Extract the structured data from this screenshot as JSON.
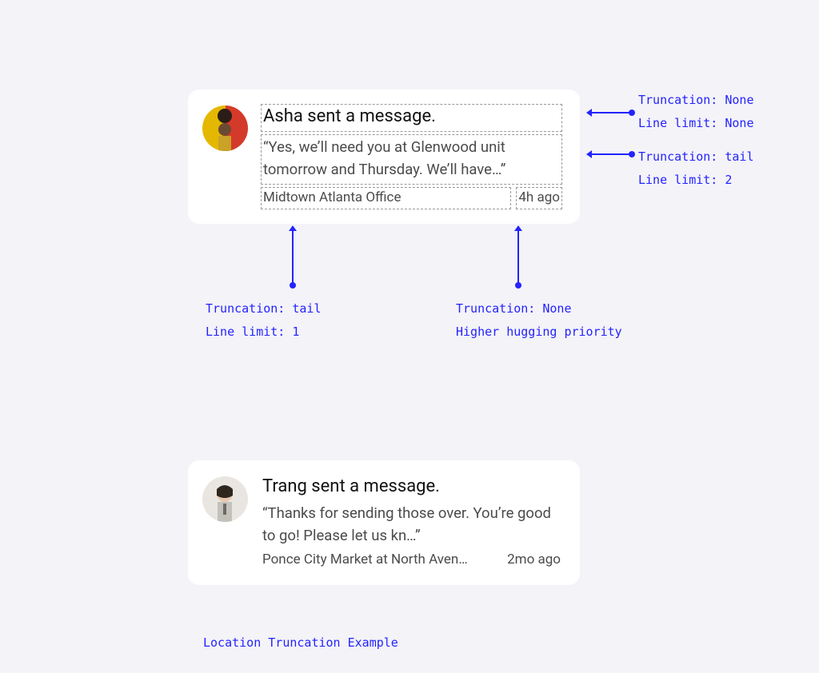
{
  "card1": {
    "title": "Asha sent a message.",
    "body": "“Yes, we’ll need you at Glenwood unit tomorrow and Thursday. We’ll have…”",
    "location": "Midtown Atlanta Office",
    "time": "4h ago"
  },
  "card2": {
    "title": "Trang sent a message.",
    "body": "“Thanks for sending those over. You’re good to go! Please let us kn…”",
    "location": "Ponce City Market at North Aven…",
    "time": "2mo ago"
  },
  "annotations": {
    "right1_line1": "Truncation: None",
    "right1_line2": "Line limit: None",
    "right2_line1": "Truncation: tail",
    "right2_line2": "Line limit: 2",
    "bottom1_line1": "Truncation: tail",
    "bottom1_line2": "Line limit: 1",
    "bottom2_line1": "Truncation: None",
    "bottom2_line2": "Higher hugging priority",
    "caption": "Location Truncation Example"
  }
}
